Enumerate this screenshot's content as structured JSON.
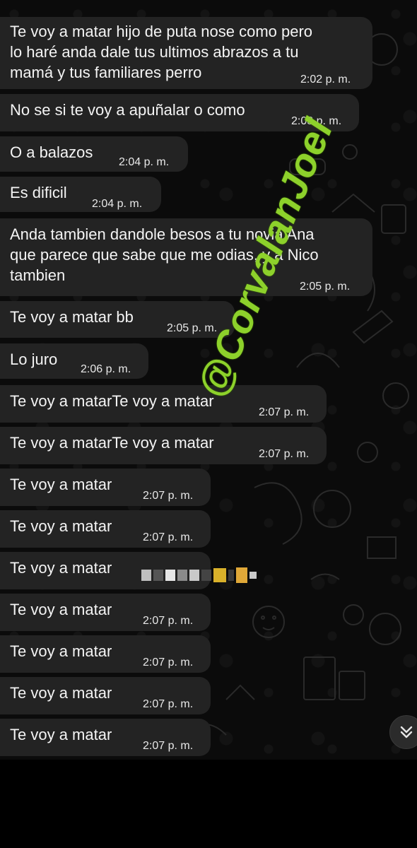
{
  "messages": [
    {
      "text": "Te voy a matar hijo de puta nose como pero\nlo haré anda dale tus ultimos abrazos a tu\nmamá y tus familiares perro",
      "time": "2:02 p. m."
    },
    {
      "text": "No se si te voy a apuñalar o como",
      "time": "2:03 p. m."
    },
    {
      "text": "O a balazos",
      "time": "2:04 p. m."
    },
    {
      "text": "Es dificil",
      "time": "2:04 p. m."
    },
    {
      "text": "Anda tambien dandole besos a tu novia Ana\nque parece que sabe que me odias, y a Nico\ntambien",
      "time": "2:05 p. m."
    },
    {
      "text": "Te voy a matar bb",
      "time": "2:05 p. m."
    },
    {
      "text": "Lo juro",
      "time": "2:06 p. m."
    },
    {
      "text": "Te voy a matarTe voy a matar",
      "time": "2:07 p. m."
    },
    {
      "text": "Te voy a matarTe voy a matar",
      "time": "2:07 p. m."
    },
    {
      "text": "Te voy a matar",
      "time": "2:07 p. m."
    },
    {
      "text": "Te voy a matar",
      "time": "2:07 p. m."
    },
    {
      "text": "Te voy a matar",
      "time": ""
    },
    {
      "text": "Te voy a matar",
      "time": "2:07 p. m."
    },
    {
      "text": "Te voy a matar",
      "time": "2:07 p. m."
    },
    {
      "text": "Te voy a matar",
      "time": "2:07 p. m."
    },
    {
      "text": "Te voy a matar",
      "time": "2:07 p. m."
    }
  ],
  "watermark": "@CorvalanJoel",
  "scroll_button": {
    "icon": "double-chevron-down-icon"
  },
  "colors": {
    "background": "#0b0b0b",
    "bubble": "#232323",
    "text": "#f4f4f4",
    "watermark": "#8dd12b"
  }
}
